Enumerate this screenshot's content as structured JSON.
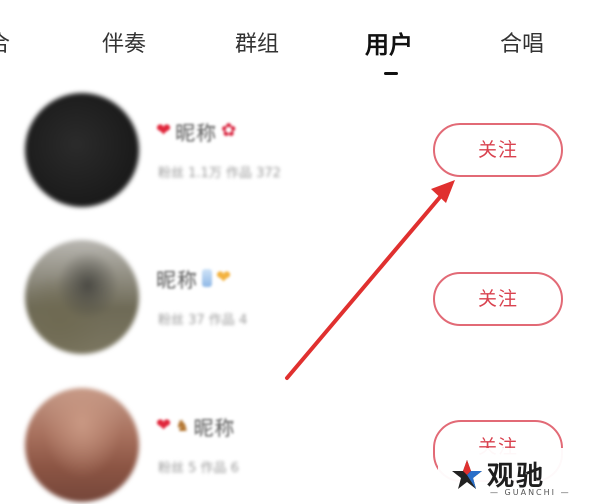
{
  "tabs": [
    {
      "label": "合",
      "active": false
    },
    {
      "label": "伴奏",
      "active": false
    },
    {
      "label": "群组",
      "active": false
    },
    {
      "label": "用户",
      "active": true
    },
    {
      "label": "合唱",
      "active": false
    }
  ],
  "users": [
    {
      "name": "昵称",
      "meta": "粉丝 1.1万 作品 372",
      "follow_label": "关注",
      "icons": [
        "heart-emoji",
        "rose-emoji"
      ]
    },
    {
      "name": "昵称",
      "meta": "粉丝 37 作品 4",
      "follow_label": "关注",
      "icons": [
        "tie-emoji",
        "yellow-heart-emoji"
      ]
    },
    {
      "name": "昵称",
      "meta": "粉丝 5 作品 6",
      "follow_label": "关注",
      "icons": [
        "heart-emoji",
        "horse-emoji"
      ]
    }
  ],
  "annotation": {
    "arrow_color": "#e0302f"
  },
  "watermark": {
    "brand_cn": "观驰",
    "brand_en": "GUANCHI",
    "star_colors": [
      "#e0302f",
      "#2a6fc9",
      "#222222"
    ]
  },
  "colors": {
    "accent": "#d9424f",
    "button_border": "#e26a76",
    "active_tab": "#111111",
    "inactive_tab": "#333333"
  }
}
